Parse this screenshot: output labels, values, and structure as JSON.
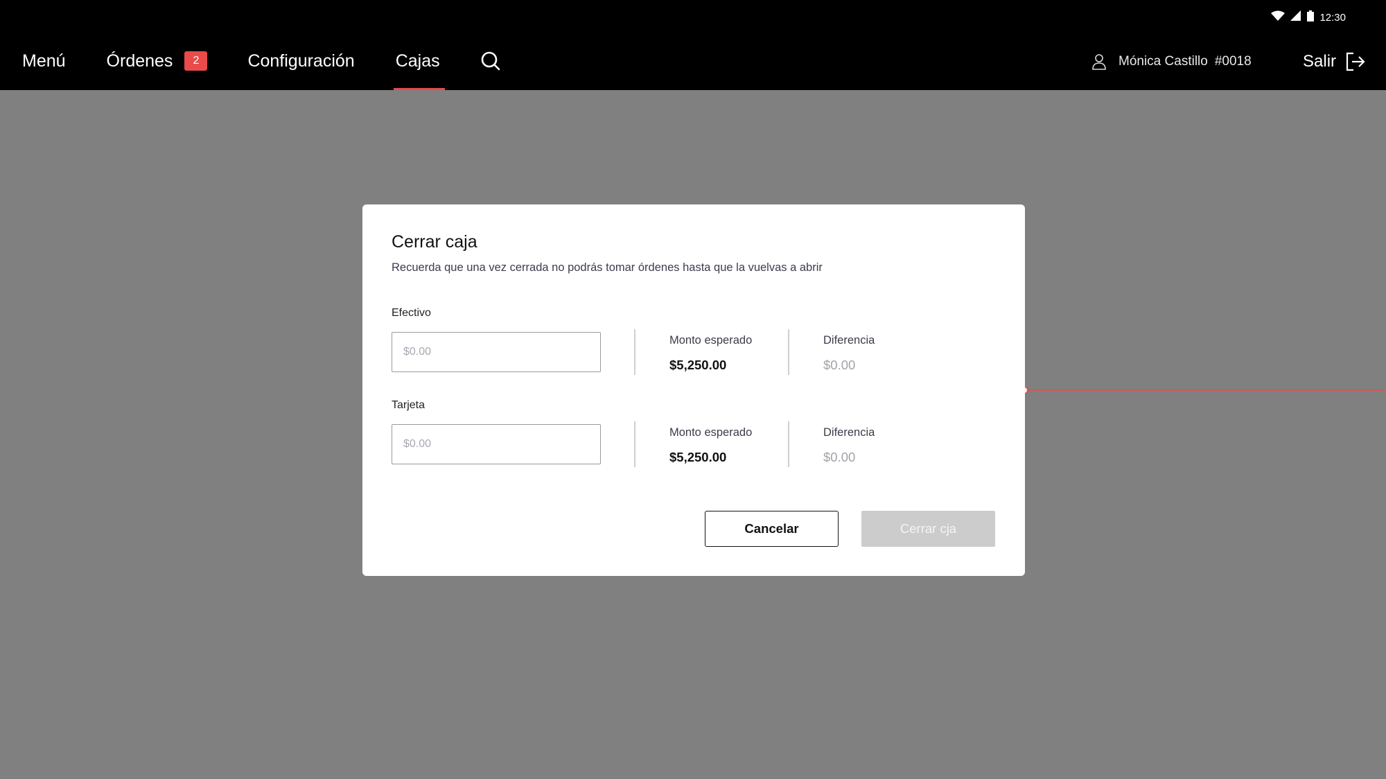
{
  "status": {
    "time": "12:30"
  },
  "nav": {
    "items": [
      {
        "label": "Menú"
      },
      {
        "label": "Órdenes",
        "badge": "2"
      },
      {
        "label": "Configuración"
      },
      {
        "label": "Cajas",
        "active": true
      }
    ]
  },
  "user": {
    "name": "Mónica Castillo",
    "id": "#0018"
  },
  "logout": {
    "label": "Salir"
  },
  "modal": {
    "title": "Cerrar caja",
    "subtitle": "Recuerda que una vez cerrada no podrás tomar órdenes hasta que la vuelvas a abrir",
    "sections": [
      {
        "label": "Efectivo",
        "input_placeholder": "$0.00",
        "input_value": "",
        "expected_label": "Monto esperado",
        "expected_value": "$5,250.00",
        "diff_label": "Diferencia",
        "diff_value": "$0.00"
      },
      {
        "label": "Tarjeta",
        "input_placeholder": "$0.00",
        "input_value": "",
        "expected_label": "Monto esperado",
        "expected_value": "$5,250.00",
        "diff_label": "Diferencia",
        "diff_value": "$0.00"
      }
    ],
    "cancel_label": "Cancelar",
    "confirm_label": "Cerrar cja"
  },
  "colors": {
    "accent": "#e94b4b",
    "topbar": "#000000",
    "overlay": "#808080",
    "disabled_button": "#cccccc"
  }
}
